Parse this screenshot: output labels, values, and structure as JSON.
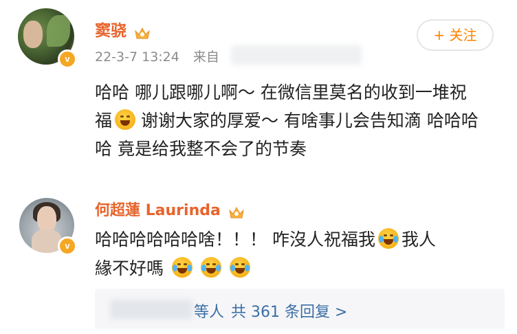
{
  "post": {
    "author": "窦骁",
    "date": "22-3-7 13:24",
    "source_prefix": "来自",
    "follow_label": "+ 关注",
    "text_line1": "哈哈 哪儿跟哪儿啊～ 在微信里莫名的收到一堆祝",
    "text_line2_a": "福",
    "text_line2_b": " 谢谢大家的厚爱～ 有啥事儿会告知滴 哈哈哈",
    "text_line3": "哈 竟是给我整不会了的节奏"
  },
  "comment": {
    "author": "何超蓮 Laurinda",
    "text_line1_a": "哈哈哈哈哈哈啥！！！ 咋沒人祝福我",
    "text_line1_b": "我人",
    "text_line2": "緣不好嗎"
  },
  "replies": {
    "suffix": "等人",
    "count_text": "共 361 条回复 >"
  },
  "icons": [
    "crown-icon",
    "verified-badge-icon",
    "emoji-icon",
    "laugh-cry-emoji-icon"
  ],
  "colors": {
    "name_orange": "#e8642c",
    "follow_orange": "#ff8200",
    "badge": "#f5a623",
    "link_blue": "#3a6ea5",
    "meta_gray": "#8b8b8b"
  }
}
